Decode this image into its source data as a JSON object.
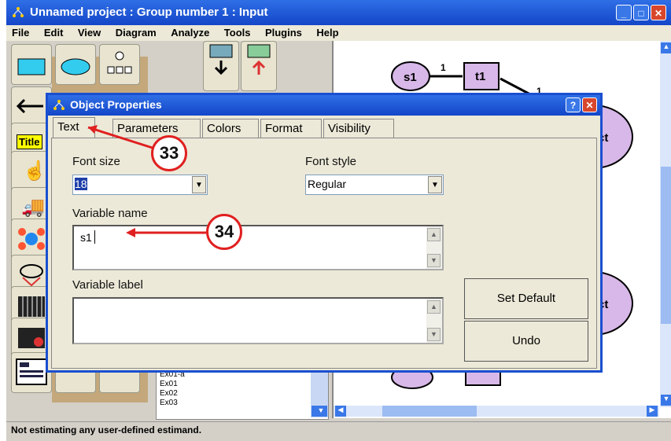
{
  "window": {
    "title": "Unnamed project : Group number 1 : Input",
    "controls": [
      "_",
      "□",
      "✕"
    ]
  },
  "menu": [
    "File",
    "Edit",
    "View",
    "Diagram",
    "Analyze",
    "Tools",
    "Plugins",
    "Help"
  ],
  "files_list": [
    "Ex01-a",
    "Ex01",
    "Ex02",
    "Ex03"
  ],
  "diagram": {
    "nodes": [
      "s1",
      "t1",
      "ct",
      "ct"
    ],
    "edge_labels": [
      "1",
      "1"
    ]
  },
  "status": "Not estimating any user-defined estimand.",
  "dialog": {
    "title": "Object Properties",
    "help_label": "?",
    "close_label": "✕",
    "tabs": [
      "Text",
      "Parameters",
      "Colors",
      "Format",
      "Visibility"
    ],
    "active_tab": "Text",
    "font_size_label": "Font size",
    "font_size_value": "18",
    "font_style_label": "Font style",
    "font_style_value": "Regular",
    "variable_name_label": "Variable name",
    "variable_name_value": "s1",
    "variable_label_label": "Variable label",
    "variable_label_value": "",
    "set_default_label": "Set Default",
    "undo_label": "Undo"
  },
  "callouts": [
    "33",
    "34"
  ],
  "colors": {
    "titlebar": "#1346c8",
    "callout_border": "#e02020",
    "node_fill": "#d7b8e8",
    "arrow": "#d82020"
  }
}
